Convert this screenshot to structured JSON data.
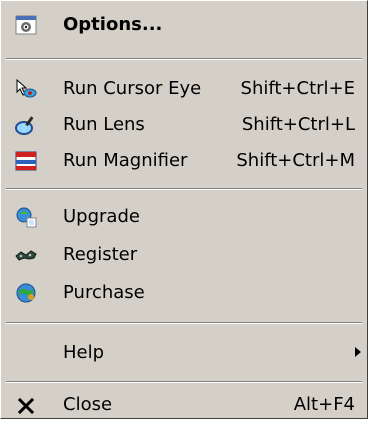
{
  "menu": {
    "options": {
      "label": "Options...",
      "icon": "options-icon"
    },
    "run_cursor_eye": {
      "label": "Run Cursor Eye",
      "shortcut": "Shift+Ctrl+E",
      "icon": "cursor-eye-icon"
    },
    "run_lens": {
      "label": "Run Lens",
      "shortcut": "Shift+Ctrl+L",
      "icon": "lens-icon"
    },
    "run_magnifier": {
      "label": "Run Magnifier",
      "shortcut": "Shift+Ctrl+M",
      "icon": "magnifier-icon"
    },
    "upgrade": {
      "label": "Upgrade",
      "icon": "upgrade-icon"
    },
    "register": {
      "label": "Register",
      "icon": "register-icon"
    },
    "purchase": {
      "label": "Purchase",
      "icon": "purchase-icon"
    },
    "help": {
      "label": "Help",
      "icon": "submenu-arrow-icon"
    },
    "close": {
      "label": "Close",
      "shortcut": "Alt+F4",
      "icon": "close-icon"
    }
  }
}
